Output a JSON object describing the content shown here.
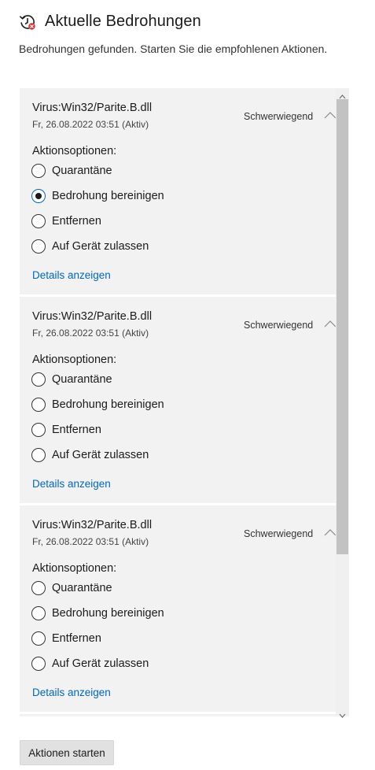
{
  "header": {
    "title": "Aktuelle Bedrohungen",
    "icon": "history-shield-alert-icon",
    "icon_accent_color": "#d13438",
    "subtitle": "Bedrohungen gefunden. Starten Sie die empfohlenen Aktionen."
  },
  "threats": [
    {
      "name": "Virus:Win32/Parite.B.dll",
      "date": "Fr, 26.08.2022 03:51 (Aktiv)",
      "severity": "Schwerwiegend",
      "actions_label": "Aktionsoptionen:",
      "options": [
        {
          "label": "Quarantäne",
          "selected": false
        },
        {
          "label": "Bedrohung bereinigen",
          "selected": true
        },
        {
          "label": "Entfernen",
          "selected": false
        },
        {
          "label": "Auf Gerät zulassen",
          "selected": false
        }
      ],
      "details_link": "Details anzeigen"
    },
    {
      "name": "Virus:Win32/Parite.B.dll",
      "date": "Fr, 26.08.2022 03:51 (Aktiv)",
      "severity": "Schwerwiegend",
      "actions_label": "Aktionsoptionen:",
      "options": [
        {
          "label": "Quarantäne",
          "selected": false
        },
        {
          "label": "Bedrohung bereinigen",
          "selected": false
        },
        {
          "label": "Entfernen",
          "selected": false
        },
        {
          "label": "Auf Gerät zulassen",
          "selected": false
        }
      ],
      "details_link": "Details anzeigen"
    },
    {
      "name": "Virus:Win32/Parite.B.dll",
      "date": "Fr, 26.08.2022 03:51 (Aktiv)",
      "severity": "Schwerwiegend",
      "actions_label": "Aktionsoptionen:",
      "options": [
        {
          "label": "Quarantäne",
          "selected": false
        },
        {
          "label": "Bedrohung bereinigen",
          "selected": false
        },
        {
          "label": "Entfernen",
          "selected": false
        },
        {
          "label": "Auf Gerät zulassen",
          "selected": false
        }
      ],
      "details_link": "Details anzeigen"
    }
  ],
  "start_button_label": "Aktionen starten",
  "colors": {
    "link": "#0067c0",
    "card_background": "#f2f2f2",
    "scroll_thumb": "#c2c2c2"
  }
}
